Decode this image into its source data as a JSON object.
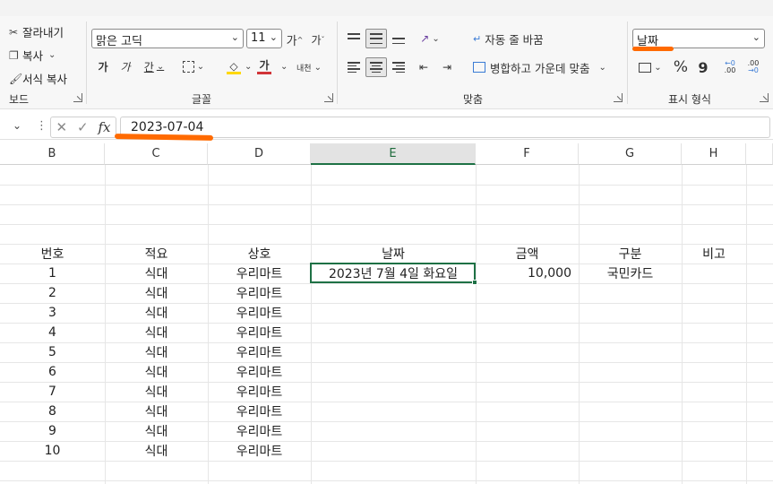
{
  "clipboard": {
    "cut_label": "잘라내기",
    "copy_label": "복사",
    "format_painter_label": "서식 복사",
    "group_label": "보드"
  },
  "font": {
    "font_name": "맑은 고딕",
    "font_size": "11",
    "grow_label": "가",
    "shrink_label": "가",
    "bold_label": "가",
    "italic_label": "가",
    "underline_label": "간",
    "font_color_label": "가",
    "phonetic_label": "내천",
    "group_label": "글꼴",
    "font_color": "#d13438",
    "fill_color": "#ffd800"
  },
  "alignment": {
    "wrap_text_label": "자동 줄 바꿈",
    "merge_center_label": "병합하고 가운데 맞춤",
    "group_label": "맞춤"
  },
  "number": {
    "format_value": "날짜",
    "percent_label": "%",
    "comma_label": "9",
    "inc_decimal_label": ".00",
    "dec_decimal_label": ".00",
    "group_label": "표시 형식"
  },
  "formula_bar": {
    "fx_label": "fx",
    "value": "2023-07-04"
  },
  "columns": [
    "B",
    "C",
    "D",
    "E",
    "F",
    "G",
    "H"
  ],
  "table": {
    "headers": [
      "번호",
      "적요",
      "상호",
      "날짜",
      "금액",
      "구분",
      "비고"
    ],
    "rows": [
      [
        "1",
        "식대",
        "우리마트",
        "2023년 7월 4일 화요일",
        "10,000",
        "국민카드",
        ""
      ],
      [
        "2",
        "식대",
        "우리마트",
        "",
        "",
        "",
        ""
      ],
      [
        "3",
        "식대",
        "우리마트",
        "",
        "",
        "",
        ""
      ],
      [
        "4",
        "식대",
        "우리마트",
        "",
        "",
        "",
        ""
      ],
      [
        "5",
        "식대",
        "우리마트",
        "",
        "",
        "",
        ""
      ],
      [
        "6",
        "식대",
        "우리마트",
        "",
        "",
        "",
        ""
      ],
      [
        "7",
        "식대",
        "우리마트",
        "",
        "",
        "",
        ""
      ],
      [
        "8",
        "식대",
        "우리마트",
        "",
        "",
        "",
        ""
      ],
      [
        "9",
        "식대",
        "우리마트",
        "",
        "",
        "",
        ""
      ],
      [
        "10",
        "식대",
        "우리마트",
        "",
        "",
        "",
        ""
      ]
    ]
  },
  "colors": {
    "accent_green": "#1e7145",
    "annotation_orange": "#ff6a00"
  }
}
